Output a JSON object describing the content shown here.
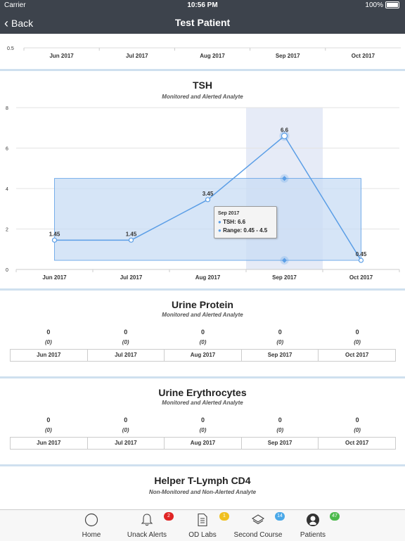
{
  "status_bar": {
    "carrier": "Carrier",
    "time": "10:56 PM",
    "battery": "100%"
  },
  "nav": {
    "back_label": "Back",
    "title": "Test Patient"
  },
  "months": [
    "Jun 2017",
    "Jul 2017",
    "Aug 2017",
    "Sep 2017",
    "Oct 2017"
  ],
  "top_partial": {
    "y_tick": "0.5"
  },
  "tsh": {
    "title": "TSH",
    "subtitle": "Monitored and Alerted Analyte",
    "tooltip": {
      "month": "Sep 2017",
      "value_line": "TSH: 6.6",
      "range_line": "Range: 0.45 - 4.5"
    }
  },
  "chart_data": {
    "type": "line",
    "title": "TSH",
    "subtitle": "Monitored and Alerted Analyte",
    "categories": [
      "Jun 2017",
      "Jul 2017",
      "Aug 2017",
      "Sep 2017",
      "Oct 2017"
    ],
    "series": [
      {
        "name": "TSH",
        "values": [
          1.45,
          1.45,
          3.45,
          6.6,
          0.45
        ]
      }
    ],
    "range": {
      "name": "Range",
      "low": 0.45,
      "high": 4.5
    },
    "ylim": [
      0,
      8
    ],
    "yticks": [
      0,
      2,
      4,
      6,
      8
    ],
    "highlighted_category": "Sep 2017",
    "colors": {
      "line": "#5b9ee6",
      "range_band": "#c8dcf4",
      "highlight": "#e6ebf7"
    }
  },
  "urine_protein": {
    "title": "Urine Protein",
    "subtitle": "Monitored and Alerted Analyte",
    "values": [
      "0",
      "0",
      "0",
      "0",
      "0"
    ],
    "subvalues": [
      "(0)",
      "(0)",
      "(0)",
      "(0)",
      "(0)"
    ]
  },
  "urine_erythrocytes": {
    "title": "Urine Erythrocytes",
    "subtitle": "Monitored and Alerted Analyte",
    "values": [
      "0",
      "0",
      "0",
      "0",
      "0"
    ],
    "subvalues": [
      "(0)",
      "(0)",
      "(0)",
      "(0)",
      "(0)"
    ]
  },
  "helper_t": {
    "title": "Helper T-Lymph CD4",
    "subtitle": "Non-Monitored and Non-Alerted Analyte"
  },
  "tabs": [
    {
      "label": "Home",
      "icon": "home-icon",
      "badge": ""
    },
    {
      "label": "Unack Alerts",
      "icon": "bell-icon",
      "badge": "2",
      "badge_color": "#e02424"
    },
    {
      "label": "OD Labs",
      "icon": "document-icon",
      "badge": "1",
      "badge_color": "#f0c020"
    },
    {
      "label": "Second Course",
      "icon": "layers-icon",
      "badge": "14",
      "badge_color": "#4aa8e8"
    },
    {
      "label": "Patients",
      "icon": "patient-icon",
      "badge": "47",
      "badge_color": "#4cba4c"
    }
  ]
}
